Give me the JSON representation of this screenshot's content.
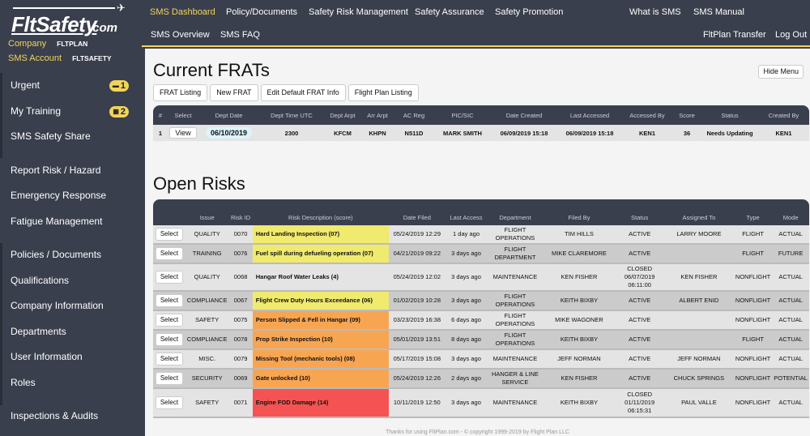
{
  "brand": {
    "name": "FltSafety",
    "suffix": ".com"
  },
  "account": {
    "company_label": "Company",
    "company_value": "FLTPLAN",
    "sms_label": "SMS Account",
    "sms_value": "FLTSAFETY"
  },
  "sidebar": {
    "items": [
      {
        "label": "Urgent",
        "badge": "1",
        "badge_icon": "inbox-icon"
      },
      {
        "label": "My Training",
        "badge": "2",
        "badge_icon": "calendar-icon"
      },
      {
        "label": "SMS Safety Share"
      },
      {
        "label": "Report Risk / Hazard"
      },
      {
        "label": "Emergency Response"
      },
      {
        "label": "Fatigue Management"
      },
      {
        "label": "Policies / Documents"
      },
      {
        "label": "Qualifications"
      },
      {
        "label": "Company Information"
      },
      {
        "label": "Departments"
      },
      {
        "label": "User Information"
      },
      {
        "label": "Roles"
      },
      {
        "label": "Inspections & Audits"
      }
    ]
  },
  "topnav": {
    "row1": [
      "SMS Dashboard",
      "Policy/Documents",
      "Safety Risk Management",
      "Safety Assurance",
      "Safety Promotion",
      "What is SMS",
      "SMS Manual"
    ],
    "row2": [
      "SMS Overview",
      "SMS FAQ",
      "FltPlan Transfer",
      "Log Out"
    ],
    "active": "SMS Dashboard",
    "accent_color": "#f2d45a"
  },
  "frats": {
    "title": "Current FRATs",
    "hide_menu": "Hide Menu",
    "buttons": [
      "FRAT Listing",
      "New FRAT",
      "Edit Default FRAT Info",
      "Flight Plan Listing"
    ],
    "columns": [
      "#",
      "Select",
      "Dept Date",
      "Dept Time UTC",
      "Dept Arpt",
      "Arr Arpt",
      "AC Reg",
      "PIC/SIC",
      "Date Created",
      "Last Accessed",
      "Accessed By",
      "Score",
      "Status",
      "Created By"
    ],
    "rows": [
      {
        "num": "1",
        "select": "View",
        "dept_date": "06/10/2019",
        "dept_time": "2300",
        "dept_arpt": "KFCM",
        "arr_arpt": "KHPN",
        "ac_reg": "N511D",
        "pic_sic": "MARK SMITH",
        "date_created": "06/09/2019 15:18",
        "last_accessed": "06/09/2019 15:18",
        "accessed_by": "KEN1",
        "score": "36",
        "status": "Needs Updating",
        "created_by": "KEN1"
      }
    ]
  },
  "risks": {
    "title": "Open Risks",
    "columns": [
      "",
      "Issue",
      "Risk ID",
      "Risk Description (score)",
      "Date Filed",
      "Last Access",
      "Department",
      "Filed By",
      "Status",
      "Assigned To",
      "Type",
      "Mode"
    ],
    "severity_colors": {
      "yellow": "#f0ea6e",
      "orange": "#f8a552",
      "red": "#f55353",
      "none": ""
    },
    "rows": [
      {
        "select": "Select",
        "issue": "QUALITY",
        "id": "0070",
        "desc": "Hard Landing Inspection (07)",
        "severity": "yellow",
        "date_filed": "05/24/2019 12:29",
        "last_access": "1 day ago",
        "department": "FLIGHT OPERATIONS",
        "filed_by": "TIM HILLS",
        "status": "ACTIVE",
        "assigned_to": "LARRY MOORE",
        "type": "FLIGHT",
        "mode": "ACTUAL"
      },
      {
        "select": "Select",
        "issue": "TRAINING",
        "id": "0076",
        "desc": "Fuel spill during defueling operation (07)",
        "severity": "yellow",
        "date_filed": "04/21/2019 09:22",
        "last_access": "3 days ago",
        "department": "FLIGHT DEPARTMENT",
        "filed_by": "MIKE CLAREMORE",
        "status": "ACTIVE",
        "assigned_to": "",
        "type": "FLIGHT",
        "mode": "FUTURE"
      },
      {
        "select": "Select",
        "issue": "QUALITY",
        "id": "0068",
        "desc": "Hangar Roof Water Leaks (4)",
        "severity": "none",
        "date_filed": "05/24/2019 12:02",
        "last_access": "3 days ago",
        "department": "MAINTENANCE",
        "filed_by": "KEN FISHER",
        "status": "CLOSED 06/07/2019 06:11:00",
        "assigned_to": "KEN FISHER",
        "type": "NONFLIGHT",
        "mode": "ACTUAL"
      },
      {
        "select": "Select",
        "issue": "COMPLIANCE",
        "id": "0067",
        "desc": "Flight Crew Duty Hours Exceedance (06)",
        "severity": "yellow",
        "date_filed": "01/02/2019 10:28",
        "last_access": "3 days ago",
        "department": "FLIGHT OPERATIONS",
        "filed_by": "KEITH BIXBY",
        "status": "ACTIVE",
        "assigned_to": "ALBERT ENID",
        "type": "NONFLIGHT",
        "mode": "ACTUAL"
      },
      {
        "select": "Select",
        "issue": "SAFETY",
        "id": "0075",
        "desc": "Person Slipped & Fell in Hangar (09)",
        "severity": "orange",
        "date_filed": "03/23/2019 16:38",
        "last_access": "6 days ago",
        "department": "FLIGHT OPERATIONS",
        "filed_by": "MIKE WAGONER",
        "status": "ACTIVE",
        "assigned_to": "",
        "type": "NONFLIGHT",
        "mode": "ACTUAL"
      },
      {
        "select": "Select",
        "issue": "COMPLIANCE",
        "id": "0078",
        "desc": "Prop Strike Inspection (10)",
        "severity": "orange",
        "date_filed": "05/01/2019 13:51",
        "last_access": "8 days ago",
        "department": "FLIGHT OPERATIONS",
        "filed_by": "KEITH BIXBY",
        "status": "ACTIVE",
        "assigned_to": "",
        "type": "FLIGHT",
        "mode": "ACTUAL"
      },
      {
        "select": "Select",
        "issue": "MISC.",
        "id": "0079",
        "desc": "Missing Tool (mechanic tools) (08)",
        "severity": "orange",
        "date_filed": "05/17/2019 15:08",
        "last_access": "3 days ago",
        "department": "MAINTENANCE",
        "filed_by": "JEFF NORMAN",
        "status": "ACTIVE",
        "assigned_to": "JEFF NORMAN",
        "type": "NONFLIGHT",
        "mode": "ACTUAL"
      },
      {
        "select": "Select",
        "issue": "SECURITY",
        "id": "0069",
        "desc": "Gate unlocked (10)",
        "severity": "orange",
        "date_filed": "05/24/2019 12:26",
        "last_access": "2 days ago",
        "department": "HANGER & LINE SERVICE",
        "filed_by": "KEN FISHER",
        "status": "ACTIVE",
        "assigned_to": "CHUCK SPRINGS",
        "type": "NONFLIGHT",
        "mode": "POTENTIAL"
      },
      {
        "select": "Select",
        "issue": "SAFETY",
        "id": "0071",
        "desc": "Engine FOD Damage (14)",
        "severity": "red",
        "date_filed": "10/11/2019 12:50",
        "last_access": "3 days ago",
        "department": "MAINTENANCE",
        "filed_by": "KEITH BIXBY",
        "status": "CLOSED 01/11/2019 06:15:31",
        "assigned_to": "PAUL VALLE",
        "type": "NONFLIGHT",
        "mode": "ACTUAL"
      }
    ]
  },
  "footer": "Thanks for using FltPlan.com - © copyright 1999-2019 by Flight Plan LLC"
}
